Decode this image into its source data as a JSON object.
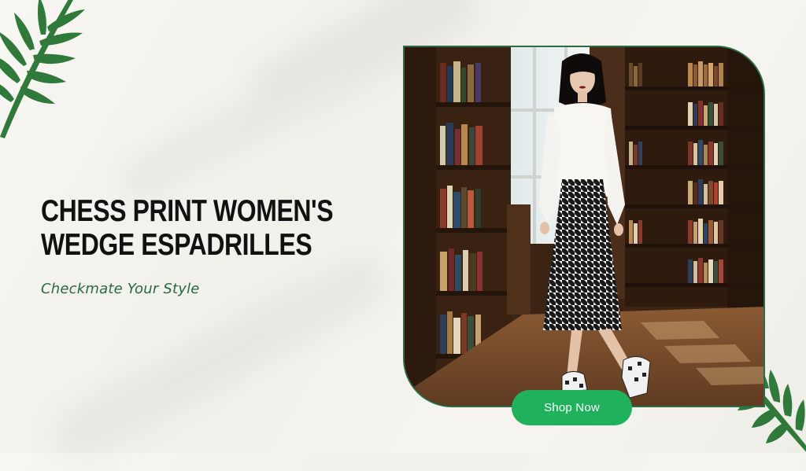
{
  "banner": {
    "headline_line1": "CHESS PRINT WOMEN'S",
    "headline_line2": "WEDGE ESPADRILLES",
    "tagline": "Checkmate Your Style",
    "cta_label": "Shop Now"
  },
  "colors": {
    "accent_green": "#1fb15c",
    "tagline_green": "#2b6a40",
    "frame_border": "#2e6b45",
    "headline": "#111111"
  },
  "icons": [
    "palm-leaf-icon",
    "palm-leaf-icon"
  ]
}
